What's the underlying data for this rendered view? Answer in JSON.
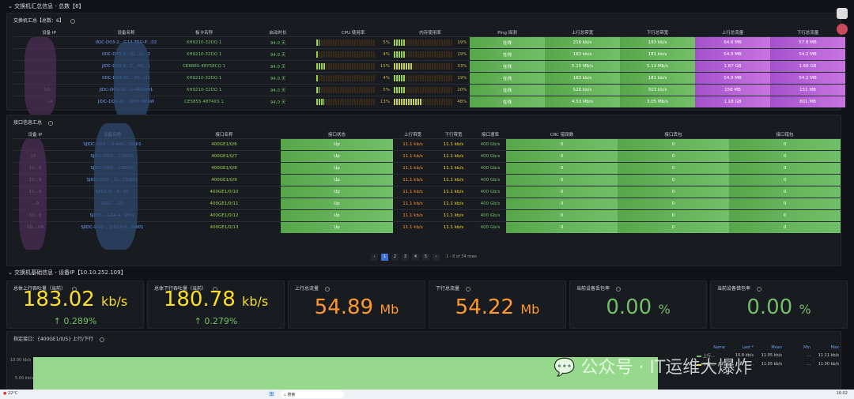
{
  "section1": {
    "title": "交换机汇总信息 - 总数【6】"
  },
  "switch_panel": {
    "title": "交换机汇总【总数：6】",
    "headers": [
      "设备 IP",
      "设备名称",
      "板卡名称",
      "启动时长",
      "CPU 使用率",
      "内存使用率",
      "Ping 探测",
      "上行总带宽",
      "下行总带宽",
      "上行总流量",
      "下行总流量"
    ],
    "rows": [
      {
        "ip": "",
        "name": "IIDC-D03-2…G14-35U-P…02",
        "card": "XH9210-32DQ 1",
        "uptime": "94.0 天",
        "cpu": 5,
        "cpu_label": "5%",
        "mem": 19,
        "mem_label": "19%",
        "ping": "在线",
        "up_bw": "216 kb/s",
        "down_bw": "193 kb/s",
        "up_tr": "64.6 MB",
        "down_tr": "57.8 MB"
      },
      {
        "ip": "",
        "name": "IIDC-D03-2…01…U…2",
        "card": "XH9210-32DQ 1",
        "uptime": "94.0 天",
        "cpu": 4,
        "cpu_label": "4%",
        "mem": 19,
        "mem_label": "19%",
        "ping": "在线",
        "up_bw": "183 kb/s",
        "down_bw": "181 kb/s",
        "up_tr": "54.9 MB",
        "down_tr": "54.2 MB"
      },
      {
        "ip": "",
        "name": "JIDC-D03-2…C…AS…1",
        "card": "CE8885-48YS8CQ 1",
        "uptime": "94.0 天",
        "cpu": 15,
        "cpu_label": "15%",
        "mem": 33,
        "mem_label": "33%",
        "ping": "在线",
        "up_bw": "5.15 Mb/s",
        "down_bw": "5.13 Mb/s",
        "up_tr": "1.67 GB",
        "down_tr": "1.66 GB"
      },
      {
        "ip": "",
        "name": "IIDC-D03-20…-PC…01",
        "card": "XH9210-32DQ 1",
        "uptime": "94.0 天",
        "cpu": 4,
        "cpu_label": "4%",
        "mem": 19,
        "mem_label": "19%",
        "ping": "在线",
        "up_bw": "183 kb/s",
        "down_bw": "181 kb/s",
        "up_tr": "54.9 MB",
        "down_tr": "54.2 MB"
      },
      {
        "ip": "10…",
        "name": "JIDC-D03-20…U-PASW01",
        "card": "XH9210-32DQ 1",
        "uptime": "94.0 天",
        "cpu": 5,
        "cpu_label": "5%",
        "mem": 20,
        "mem_label": "20%",
        "ping": "在线",
        "up_bw": "526 kb/s",
        "down_bw": "503 kb/s",
        "up_tr": "158 MB",
        "down_tr": "151 MB"
      },
      {
        "ip": "…4",
        "name": "JIDC-D03-20…-50U-SMSW",
        "card": "CE5855-48T4XS 1",
        "uptime": "94.0 天",
        "cpu": 13,
        "cpu_label": "13%",
        "mem": 48,
        "mem_label": "48%",
        "ping": "在线",
        "up_bw": "4.53 Mb/s",
        "down_bw": "3.05 Mb/s",
        "up_tr": "1.18 GB",
        "down_tr": "801 MB"
      }
    ]
  },
  "iface_panel": {
    "title": "接口信息汇总",
    "headers": [
      "设备 IP",
      "设备名称",
      "接口名称",
      "接口状态",
      "上行带宽",
      "下行带宽",
      "接口速率",
      "CRC 错误数",
      "接口丢包",
      "接口错包"
    ],
    "rows": [
      {
        "ip": "",
        "name": "SJIDC-D03-…4-44U…SW01",
        "iface": "400GE1/0/6",
        "status": "Up",
        "up": "11.1 kb/s",
        "down": "11.1 kb/s",
        "rate": "400 Gb/s",
        "crc": "0",
        "drop": "0",
        "err": "0"
      },
      {
        "ip": "10…",
        "name": "SJIDC-D03-…CSW01",
        "iface": "400GE1/0/7",
        "status": "Up",
        "up": "11.1 kb/s",
        "down": "11.1 kb/s",
        "rate": "400 Gb/s",
        "crc": "0",
        "drop": "0",
        "err": "0"
      },
      {
        "ip": "10…9",
        "name": "SJIDC-D03-…CSW01",
        "iface": "400GE1/0/8",
        "status": "Up",
        "up": "11.1 kb/s",
        "down": "11.1 kb/s",
        "rate": "400 Gb/s",
        "crc": "0",
        "drop": "0",
        "err": "0"
      },
      {
        "ip": "10…9",
        "name": "SJIDC-D03-…G…CSW01",
        "iface": "400GE1/0/9",
        "status": "Up",
        "up": "11.1 kb/s",
        "down": "11.1 kb/s",
        "rate": "400 Gb/s",
        "crc": "0",
        "drop": "0",
        "err": "0"
      },
      {
        "ip": "10…9",
        "name": "SJIDC-D…4…01",
        "iface": "400GE1/0/10",
        "status": "Up",
        "up": "11.1 kb/s",
        "down": "11.1 kb/s",
        "rate": "400 Gb/s",
        "crc": "0",
        "drop": "0",
        "err": "0"
      },
      {
        "ip": "…9",
        "name": "SJIDC-…01",
        "iface": "400GE1/0/11",
        "status": "Up",
        "up": "11.1 kb/s",
        "down": "11.1 kb/s",
        "rate": "400 Gb/s",
        "crc": "0",
        "drop": "0",
        "err": "0"
      },
      {
        "ip": "10…0",
        "name": "SJIDC-…G14-4…W01",
        "iface": "400GE1/0/12",
        "status": "Up",
        "up": "11.1 kb/s",
        "down": "11.1 kb/s",
        "rate": "400 Gb/s",
        "crc": "0",
        "drop": "0",
        "err": "0"
      },
      {
        "ip": "10.…09",
        "name": "SJIDC-D03-…3-G14-4…SW01",
        "iface": "400GE1/0/13",
        "status": "Up",
        "up": "11.1 kb/s",
        "down": "11.1 kb/s",
        "rate": "400 Gb/s",
        "crc": "0",
        "drop": "0",
        "err": "0"
      }
    ],
    "pagination": {
      "pages": [
        "1",
        "2",
        "3",
        "4",
        "5"
      ],
      "current": "1",
      "summary": "1 - 8 of 34 rows"
    }
  },
  "section3": {
    "title": "交换机基础信息 - 设备IP【10.10.252.109】"
  },
  "stats": [
    {
      "title": "总体上行吞吐量（当前）",
      "value": "183.02",
      "unit": "kb/s",
      "delta": "0.289%",
      "color": "#fade2a"
    },
    {
      "title": "总体下行吞吐量（当前）",
      "value": "180.78",
      "unit": "kb/s",
      "delta": "0.279%",
      "color": "#fade2a"
    },
    {
      "title": "上行总流量",
      "value": "54.89",
      "unit": "Mb",
      "color": "#ff9830"
    },
    {
      "title": "下行总流量",
      "value": "54.22",
      "unit": "Mb",
      "color": "#ff9830"
    },
    {
      "title": "当前设备丢包率",
      "value": "0.00",
      "unit": "%",
      "color": "#73bf69"
    },
    {
      "title": "当前设备错包率",
      "value": "0.00",
      "unit": "%",
      "color": "#73bf69"
    }
  ],
  "chart_panel": {
    "title": "指定接口：{400GE1/0/5} 上行/下行",
    "chart_data": {
      "type": "area",
      "y_ticks": [
        "10.00 kb/s",
        "5.00 kb/s"
      ],
      "legend": {
        "headers": [
          "Name",
          "Last *",
          "Mean",
          "Min",
          "Max"
        ],
        "rows": [
          {
            "name": "上行…",
            "color": "#73bf69",
            "last": "10.8 kb/s",
            "mean": "11.05 kb/s",
            "min": "…",
            "max": "11.11 kb/s"
          },
          {
            "name": "下行…",
            "color": "#fade2a",
            "last": "…",
            "mean": "11.05 kb/s",
            "min": "…",
            "max": "11.00 kb/s"
          }
        ]
      }
    }
  },
  "watermark": "公众号 · IT运维大爆炸",
  "taskbar": {
    "weather": "22°C",
    "search": "搜索",
    "time": "16:02"
  }
}
